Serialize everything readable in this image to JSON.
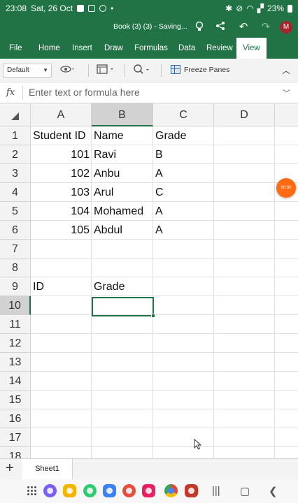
{
  "status": {
    "time": "23:08",
    "date": "Sat, 26 Oct",
    "battery": "23%"
  },
  "title": {
    "doc": "Book (3) (3) - Saving...",
    "avatar": "M"
  },
  "tabs": [
    "File",
    "Home",
    "Insert",
    "Draw",
    "Formulas",
    "Data",
    "Review",
    "View"
  ],
  "active_tab": "View",
  "toolbar": {
    "style_value": "Default",
    "freeze_label": "Freeze Panes"
  },
  "formula": {
    "fx": "fx",
    "placeholder": "Enter text or formula here"
  },
  "columns": [
    "A",
    "B",
    "C",
    "D"
  ],
  "rows": [
    "1",
    "2",
    "3",
    "4",
    "5",
    "6",
    "7",
    "8",
    "9",
    "10",
    "11",
    "12",
    "13",
    "14",
    "15",
    "16",
    "17",
    "18"
  ],
  "cells": {
    "r1": {
      "a": "Student ID",
      "b": "Name",
      "c": "Grade"
    },
    "r2": {
      "a": "101",
      "b": "Ravi",
      "c": "B"
    },
    "r3": {
      "a": "102",
      "b": "Anbu",
      "c": "A"
    },
    "r4": {
      "a": "103",
      "b": "Arul",
      "c": "C"
    },
    "r5": {
      "a": "104",
      "b": "Mohamed",
      "c": "A"
    },
    "r6": {
      "a": "105",
      "b": "Abdul",
      "c": "A"
    },
    "r9": {
      "a": "ID",
      "b": "Grade"
    }
  },
  "selected_cell": "B10",
  "bubble": "00:00",
  "sheet": {
    "name": "Sheet1",
    "add": "+"
  }
}
